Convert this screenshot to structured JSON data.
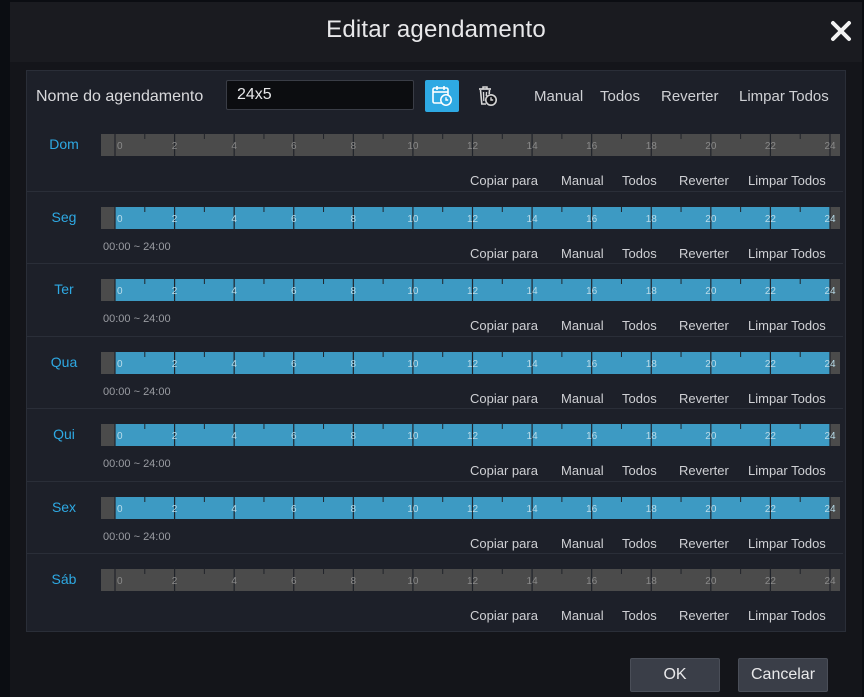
{
  "dialog": {
    "title": "Editar agendamento",
    "name_label": "Nome do agendamento",
    "name_value": "24x5",
    "top_actions": [
      "Manual",
      "Todos",
      "Reverter",
      "Limpar Todos"
    ],
    "row_actions": [
      "Copiar para",
      "Manual",
      "Todos",
      "Reverter",
      "Limpar Todos"
    ],
    "ok_label": "OK",
    "cancel_label": "Cancelar"
  },
  "timeline": {
    "hour_ticks": [
      "0",
      "2",
      "4",
      "6",
      "8",
      "10",
      "12",
      "14",
      "16",
      "18",
      "20",
      "22",
      "24"
    ],
    "colors": {
      "active": "#3d9ac3",
      "inactive": "#4b4b4b",
      "tick": "#20232a",
      "tick_label_active": "#b9dcea",
      "tick_label_inactive": "#8a8a8a",
      "day_label": "#2ea9e3"
    }
  },
  "days": [
    {
      "label": "Dom",
      "active": false,
      "range": ""
    },
    {
      "label": "Seg",
      "active": true,
      "range": "00:00 ~ 24:00"
    },
    {
      "label": "Ter",
      "active": true,
      "range": "00:00 ~ 24:00"
    },
    {
      "label": "Qua",
      "active": true,
      "range": "00:00 ~ 24:00"
    },
    {
      "label": "Qui",
      "active": true,
      "range": "00:00 ~ 24:00"
    },
    {
      "label": "Sex",
      "active": true,
      "range": "00:00 ~ 24:00"
    },
    {
      "label": "Sáb",
      "active": false,
      "range": ""
    }
  ]
}
